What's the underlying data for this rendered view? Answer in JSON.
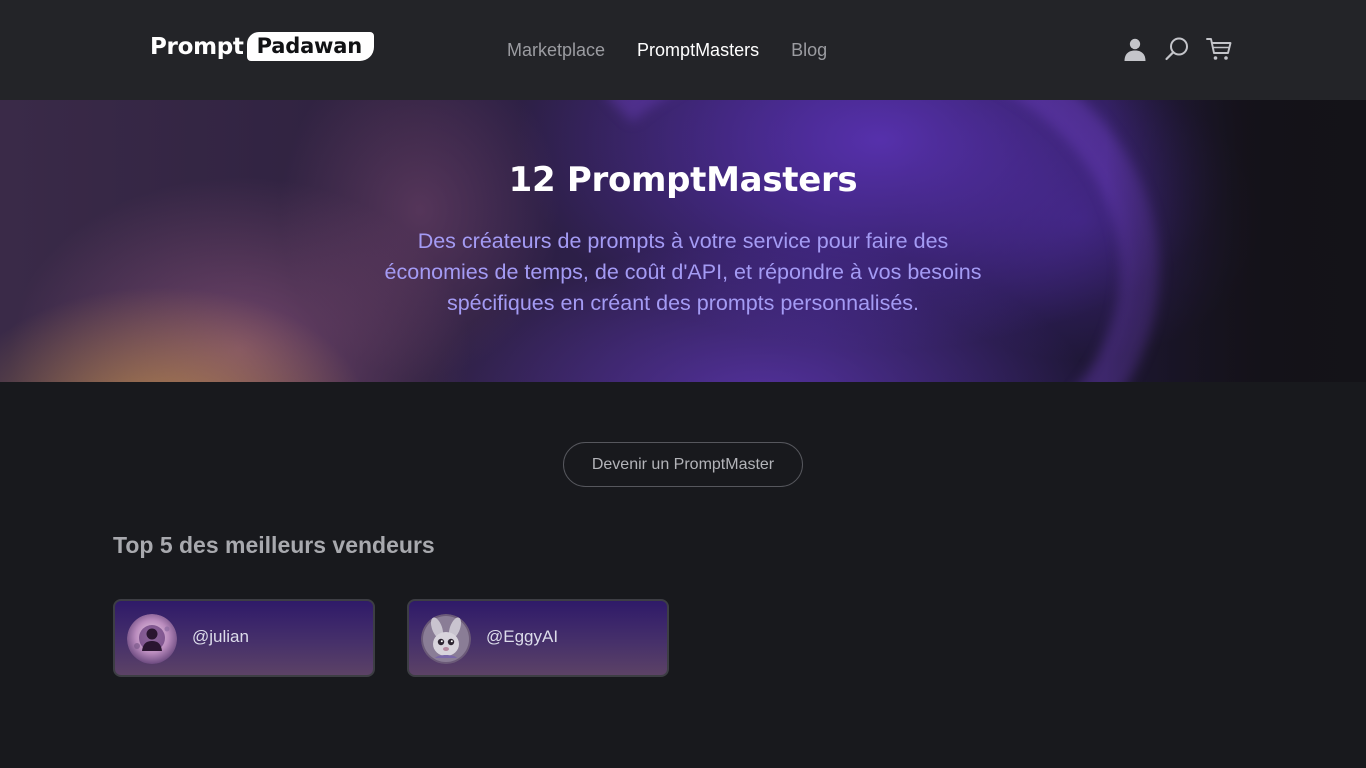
{
  "logo": {
    "part1": "Prompt",
    "part2": "Padawan"
  },
  "nav": {
    "items": [
      {
        "label": "Marketplace",
        "active": false
      },
      {
        "label": "PromptMasters",
        "active": true
      },
      {
        "label": "Blog",
        "active": false
      }
    ]
  },
  "header_icons": [
    "user-icon",
    "search-icon",
    "cart-icon"
  ],
  "hero": {
    "title": "12 PromptMasters",
    "description": "Des créateurs de prompts à votre service pour faire des économies de temps, de coût d'API, et répondre à vos besoins spécifiques en créant des prompts personnalisés."
  },
  "cta": {
    "label": "Devenir un PromptMaster"
  },
  "top_sellers": {
    "title": "Top 5 des meilleurs vendeurs",
    "sellers": [
      {
        "name": "@julian"
      },
      {
        "name": "@EggyAI"
      }
    ]
  },
  "colors": {
    "background": "#18191d",
    "header": "#232428",
    "hero_text": "#a49bf4",
    "card_top": "#2f1a69",
    "card_bottom": "#5c4266"
  }
}
